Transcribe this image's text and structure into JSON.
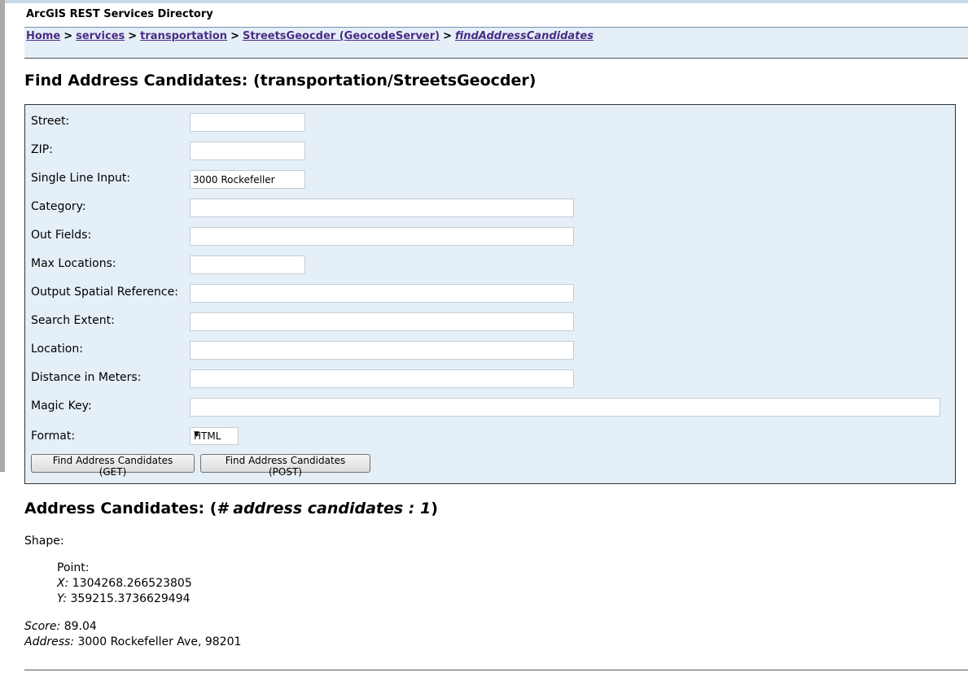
{
  "header": {
    "title": "ArcGIS REST Services Directory"
  },
  "breadcrumb": [
    {
      "label": "Home"
    },
    {
      "label": "services"
    },
    {
      "label": "transportation"
    },
    {
      "label": "StreetsGeocder (GeocodeServer)"
    },
    {
      "label": "findAddressCandidates"
    }
  ],
  "breadcrumb_sep": ">",
  "page_title": "Find Address Candidates: (transportation/StreetsGeocder)",
  "form": {
    "fields": [
      {
        "label": "Street:",
        "value": ""
      },
      {
        "label": "ZIP:",
        "value": ""
      },
      {
        "label": "Single Line Input:",
        "value": "3000 Rockefeller"
      },
      {
        "label": "Category:",
        "value": ""
      },
      {
        "label": "Out Fields:",
        "value": ""
      },
      {
        "label": "Max Locations:",
        "value": ""
      },
      {
        "label": "Output Spatial Reference:",
        "value": ""
      },
      {
        "label": "Search Extent:",
        "value": ""
      },
      {
        "label": "Location:",
        "value": ""
      },
      {
        "label": "Distance in Meters:",
        "value": ""
      },
      {
        "label": "Magic Key:",
        "value": ""
      }
    ],
    "format_label": "Format:",
    "format_value": "HTML",
    "btn_get": "Find Address Candidates (GET)",
    "btn_post": "Find Address Candidates (POST)"
  },
  "results": {
    "title_prefix": "Address Candidates: (",
    "title_italic": "# address candidates : 1",
    "title_suffix": ")",
    "shape_label": "Shape:",
    "point_label": "Point:",
    "x_label": "X:",
    "x_value": "1304268.266523805",
    "y_label": "Y:",
    "y_value": "359215.3736629494",
    "score_label": "Score:",
    "score_value": "89.04",
    "address_label": "Address:",
    "address_value": "3000 Rockefeller Ave, 98201"
  }
}
